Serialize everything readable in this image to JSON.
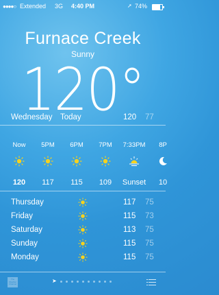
{
  "status_bar": {
    "carrier": "Extended",
    "network": "3G",
    "time": "4:40 PM",
    "battery": "74%",
    "battery_level": 0.74
  },
  "location": {
    "city": "Furnace Creek",
    "condition": "Sunny",
    "temperature": "120°"
  },
  "today": {
    "day": "Wednesday",
    "label": "Today",
    "high": "120",
    "low": "77"
  },
  "hourly": [
    {
      "time": "Now",
      "icon": "sun-icon",
      "value": "120"
    },
    {
      "time": "5PM",
      "icon": "sun-icon",
      "value": "117"
    },
    {
      "time": "6PM",
      "icon": "sun-icon",
      "value": "115"
    },
    {
      "time": "7PM",
      "icon": "sun-icon",
      "value": "109"
    },
    {
      "time": "7:33PM",
      "icon": "sunset-icon",
      "value": "Sunset"
    },
    {
      "time": "8P",
      "icon": "moon-icon",
      "value": "10"
    }
  ],
  "daily": [
    {
      "day": "Thursday",
      "icon": "sun-icon",
      "high": "117",
      "low": "75"
    },
    {
      "day": "Friday",
      "icon": "sun-icon",
      "high": "115",
      "low": "73"
    },
    {
      "day": "Saturday",
      "icon": "sun-icon",
      "high": "113",
      "low": "75"
    },
    {
      "day": "Sunday",
      "icon": "sun-icon",
      "high": "115",
      "low": "75"
    },
    {
      "day": "Monday",
      "icon": "sun-icon",
      "high": "115",
      "low": "75"
    }
  ],
  "bottom_bar": {
    "provider_logo": "The Weather Channel",
    "page_count": 10,
    "list_icon": "list-icon"
  },
  "colors": {
    "background": "#3fa6e3",
    "sun": "#f6d21e",
    "low_temp": "rgba(255,255,255,0.55)"
  }
}
